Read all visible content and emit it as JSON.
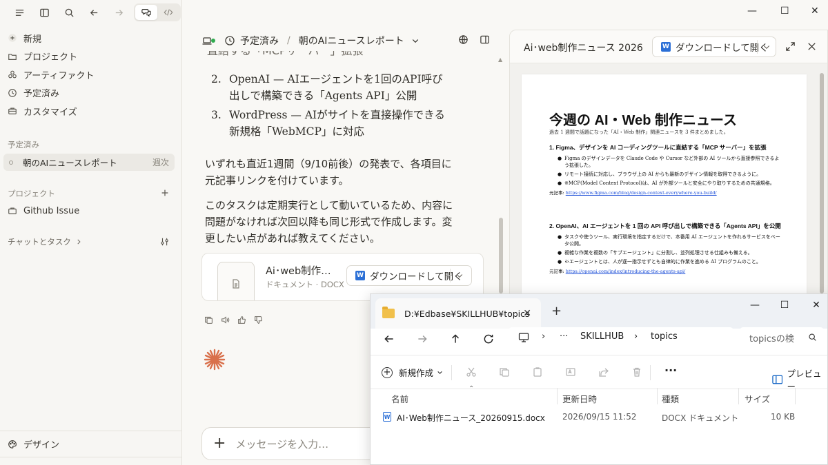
{
  "window_controls": {
    "minimize": "—",
    "maximize": "☐",
    "close": "✕"
  },
  "sidebar": {
    "nav": [
      {
        "label": "新規",
        "icon": "plus-circle-icon"
      },
      {
        "label": "プロジェクト",
        "icon": "folder-icon"
      },
      {
        "label": "アーティファクト",
        "icon": "artifact-icon"
      },
      {
        "label": "予定済み",
        "icon": "clock-icon"
      },
      {
        "label": "カスタマイズ",
        "icon": "briefcase-icon"
      }
    ],
    "scheduled_label": "予定済み",
    "scheduled_item": {
      "label": "朝のAIニュースレポート",
      "tag": "週次"
    },
    "projects_label": "プロジェクト",
    "project_item": "Github Issue",
    "chat_task_label": "チャットとタスク",
    "bottom_item": "デザイン"
  },
  "main": {
    "breadcrumb": {
      "scheduled": "予定済み",
      "sep": "/",
      "title": "朝のAIニュースレポート"
    },
    "cut_line": "直結する「MCPサーバー」拡張",
    "list": [
      {
        "num": "2.",
        "text": "OpenAI — AIエージェントを1回のAPI呼び出しで構築できる「Agents API」公開"
      },
      {
        "num": "3.",
        "text": "WordPress — AIがサイトを直接操作できる新規格「WebMCP」に対応"
      }
    ],
    "para1": "いずれも直近1週間（9/10前後）の発表で、各項目に元記事リンクを付けています。",
    "para2": "このタスクは定期実行として動いているため、内容に問題がなければ次回以降も同じ形式で作成します。変更したい点があれば教えてください。",
    "file_card": {
      "name": "Ai･web制作…",
      "meta": "ドキュメント · DOCX",
      "download": "ダウンロードして開く",
      "word_glyph": "W"
    },
    "input_placeholder": "メッセージを入力…"
  },
  "preview": {
    "title": "Ai･web制作ニュース 2026…",
    "download": "ダウンロードして開く",
    "doc": {
      "h1": "今週の AI・Web 制作ニュース",
      "subtitle": "過去 1 週間で話題になった「AI・Web 制作」関連ニュースを 3 件まとめました。",
      "sections": [
        {
          "heading": "1. Figma、デザインを AI コーディングツールに直結する「MCP サーバー」を拡張",
          "bullets": [
            "Figma のデザインデータを Claude Code や Cursor など外部の AI ツールから直接参照できるよう拡張した。",
            "リモート接続に対応し、ブラウザ上の AI からも最新のデザイン情報を取得できるように。",
            "※MCP(Model Context Protocol)は、AI が外部ツールと安全にやり取りするための共通規格。"
          ],
          "source_label": "元記事:",
          "source_url": "https://www.figma.com/blog/design-context-everywhere-you-build/"
        },
        {
          "heading": "2. OpenAI、AI エージェントを 1 回の API 呼び出しで構築できる「Agents API」を公開",
          "bullets": [
            "タスクや使うツール、実行環境を指定するだけで、本番用 AI エージェントを作れるサービスをベータ公開。",
            "複雑な作業を複数の「サブエージェント」に分割し、並列処理させる仕組みも備える。",
            "※エージェントとは、人が逐一指示せずとも自律的に作業を進める AI プログラムのこと。"
          ],
          "source_label": "元記事:",
          "source_url": "https://openai.com/index/introducing-the-agents-api/"
        }
      ]
    }
  },
  "explorer": {
    "tab_title": "D:¥Edbase¥SKILLHUB¥topics",
    "address": {
      "ellipsis": "···",
      "seg1": "SKILLHUB",
      "seg2": "topics"
    },
    "search_placeholder": "topicsの検",
    "new_label": "新規作成",
    "more_label": "···",
    "preview_label": "プレビュー",
    "columns": {
      "name": "名前",
      "date": "更新日時",
      "type": "種類",
      "size": "サイズ"
    },
    "rows": [
      {
        "name": "AI･Web制作ニュース_20260915.docx",
        "date": "2026/09/15 11:52",
        "type": "DOCX ドキュメント",
        "size": "10 KB"
      }
    ]
  },
  "colors": {
    "accent_orange": "#d9704b",
    "word_blue": "#2b6fd6",
    "online_green": "#2faa4e"
  }
}
